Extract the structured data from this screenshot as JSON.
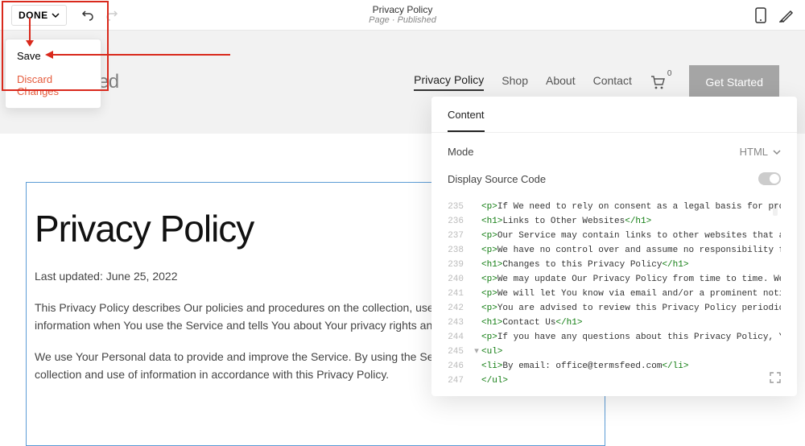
{
  "topbar": {
    "done_label": "DONE",
    "page_title": "Privacy Policy",
    "page_meta": "Page · Published"
  },
  "dropdown": {
    "save": "Save",
    "discard": "Discard Changes"
  },
  "header": {
    "logo": "TermsFeed",
    "nav": {
      "privacy": "Privacy Policy",
      "shop": "Shop",
      "about": "About",
      "contact": "Contact"
    },
    "cart_count": "0",
    "cta": "Get Started"
  },
  "doc": {
    "title": "Privacy Policy",
    "date": "Last updated: June 25, 2022",
    "p1": "This Privacy Policy describes Our policies and procedures on the collection, use and disclosure of Your information when You use the Service and tells You about Your privacy rights and how the law protects You.",
    "p2": "We use Your Personal data to provide and improve the Service. By using the Service, You agree to the collection and use of information in accordance with this Privacy Policy."
  },
  "panel": {
    "tab": "Content",
    "mode_label": "Mode",
    "mode_value": "HTML",
    "display_source": "Display Source Code",
    "code": {
      "l235": {
        "n": "235",
        "open": "<p>",
        "body": "If We need to rely on consent as a legal basis for proces"
      },
      "l236": {
        "n": "236",
        "open": "<h1>",
        "body": "Links to Other Websites",
        "close": "</h1>"
      },
      "l237": {
        "n": "237",
        "open": "<p>",
        "body": "Our Service may contain links to other websites that are n"
      },
      "l238": {
        "n": "238",
        "open": "<p>",
        "body": "We have no control over and assume no responsibility for t"
      },
      "l239": {
        "n": "239",
        "open": "<h1>",
        "body": "Changes to this Privacy Policy",
        "close": "</h1>"
      },
      "l240": {
        "n": "240",
        "open": "<p>",
        "body": "We may update Our Privacy Policy from time to time. We wil"
      },
      "l241": {
        "n": "241",
        "open": "<p>",
        "body": "We will let You know via email and/or a prominent notice o"
      },
      "l242": {
        "n": "242",
        "open": "<p>",
        "body": "You are advised to review this Privacy Policy periodically"
      },
      "l243": {
        "n": "243",
        "open": "<h1>",
        "body": "Contact Us",
        "close": "</h1>"
      },
      "l244": {
        "n": "244",
        "open": "<p>",
        "body": "If you have any questions about this Privacy Policy, You c"
      },
      "l245": {
        "n": "245",
        "open": "<ul>"
      },
      "l246": {
        "n": "246",
        "open": "<li>",
        "body": "By email: office@termsfeed.com",
        "close": "</li>"
      },
      "l247": {
        "n": "247",
        "open": "</ul>"
      }
    }
  }
}
